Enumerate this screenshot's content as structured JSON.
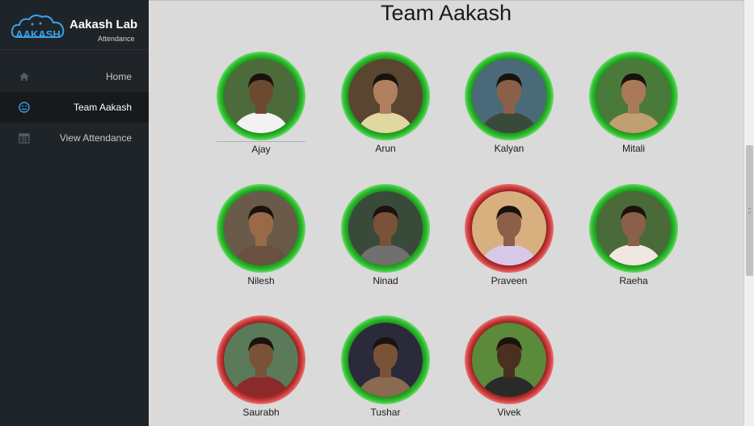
{
  "brand": {
    "logo_text": "AAKASH",
    "title": "Aakash Lab",
    "subtitle": "Attendance"
  },
  "nav": [
    {
      "label": "Home",
      "icon": "home-icon",
      "active": false
    },
    {
      "label": "Team Aakash",
      "icon": "smiley-icon",
      "active": true
    },
    {
      "label": "View Attendance",
      "icon": "calendar-icon",
      "active": false
    }
  ],
  "page": {
    "title": "Team Aakash"
  },
  "members": [
    {
      "name": "Ajay",
      "ring": "green",
      "skin": "#6b4a30",
      "bg": "#4d6b3a",
      "shirt": "#f2f2f2"
    },
    {
      "name": "Arun",
      "ring": "green",
      "skin": "#b08060",
      "bg": "#5a4630",
      "shirt": "#e0d8a0"
    },
    {
      "name": "Kalyan",
      "ring": "green",
      "skin": "#8a6048",
      "bg": "#4a6a7a",
      "shirt": "#3a4a3a"
    },
    {
      "name": "Mitali",
      "ring": "green",
      "skin": "#a87a5a",
      "bg": "#4a7a3a",
      "shirt": "#c0a070"
    },
    {
      "name": "Nilesh",
      "ring": "green",
      "skin": "#9a6a48",
      "bg": "#6a5a4a",
      "shirt": "#6a5040"
    },
    {
      "name": "Ninad",
      "ring": "green",
      "skin": "#7a5238",
      "bg": "#3a4a3a",
      "shirt": "#707070"
    },
    {
      "name": "Praveen",
      "ring": "red",
      "skin": "#8a6048",
      "bg": "#d8b080",
      "shirt": "#d8c8e8"
    },
    {
      "name": "Raeha",
      "ring": "green",
      "skin": "#8a6048",
      "bg": "#4a6a3a",
      "shirt": "#f0e8e0"
    },
    {
      "name": "Saurabh",
      "ring": "red",
      "skin": "#7a5238",
      "bg": "#5a7a5a",
      "shirt": "#8a2a2a"
    },
    {
      "name": "Tushar",
      "ring": "green",
      "skin": "#7a5238",
      "bg": "#2a2a3a",
      "shirt": "#8a6a50"
    },
    {
      "name": "Vivek",
      "ring": "red",
      "skin": "#4a3020",
      "bg": "#5a8a3a",
      "shirt": "#2a2a2a"
    }
  ]
}
